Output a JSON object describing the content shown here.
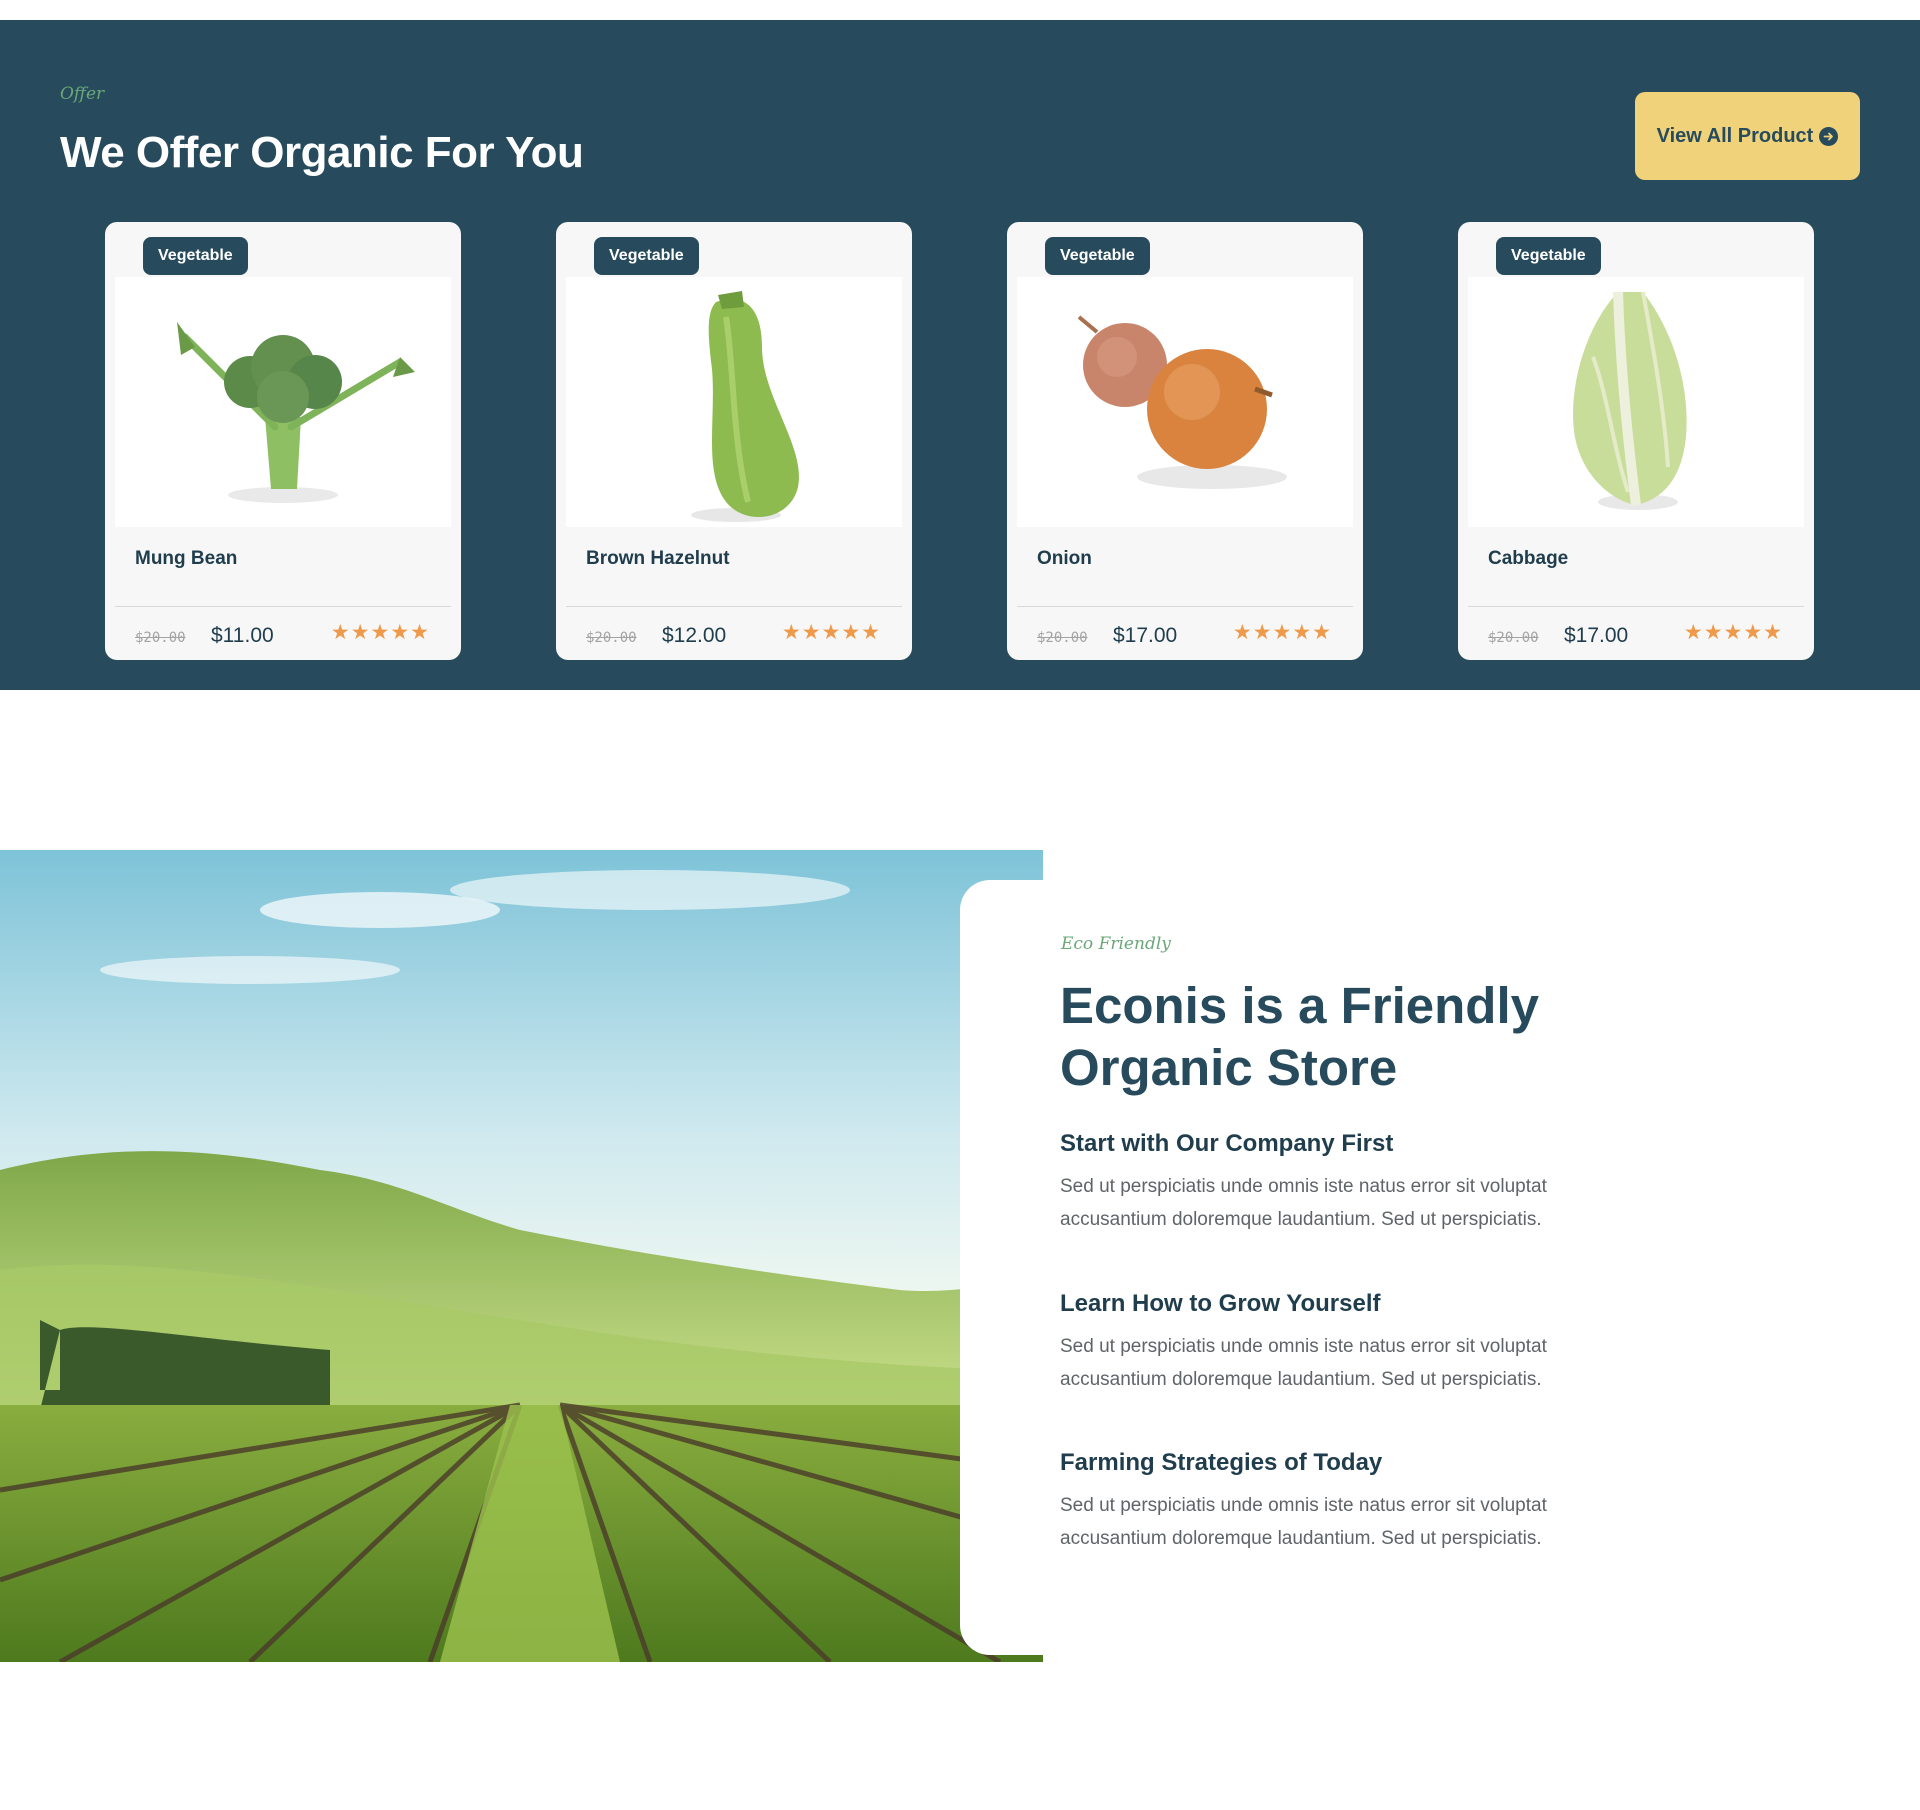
{
  "offer": {
    "tag": "Offer",
    "title": "We Offer Organic For You",
    "button_label": "View All Product",
    "products": [
      {
        "category": "Vegetable",
        "name": "Mung Bean",
        "old_price": "$20.00",
        "price": "$11.00",
        "rating": 5,
        "image_icon": "broccoli-image"
      },
      {
        "category": "Vegetable",
        "name": "Brown Hazelnut",
        "old_price": "$20.00",
        "price": "$12.00",
        "rating": 5,
        "image_icon": "zucchini-image"
      },
      {
        "category": "Vegetable",
        "name": "Onion",
        "old_price": "$20.00",
        "price": "$17.00",
        "rating": 5,
        "image_icon": "onion-image"
      },
      {
        "category": "Vegetable",
        "name": "Cabbage",
        "old_price": "$20.00",
        "price": "$17.00",
        "rating": 5,
        "image_icon": "cabbage-image"
      }
    ]
  },
  "about": {
    "tag": "Eco Friendly",
    "title": "Econis is a Friendly Organic Store",
    "features": [
      {
        "title": "Start with Our Company First",
        "text": "Sed ut perspiciatis unde omnis iste natus error sit voluptat accusantium doloremque laudantium. Sed ut perspiciatis."
      },
      {
        "title": "Learn How to Grow Yourself",
        "text": "Sed ut perspiciatis unde omnis iste natus error sit voluptat accusantium doloremque laudantium. Sed ut perspiciatis."
      },
      {
        "title": "Farming Strategies of Today",
        "text": "Sed ut perspiciatis unde omnis iste natus error sit voluptat accusantium doloremque laudantium. Sed ut perspiciatis."
      }
    ]
  },
  "colors": {
    "band": "#274b5c",
    "accent_button": "#efd27a",
    "star": "#ef9a4a",
    "script_green": "#6aa779"
  }
}
